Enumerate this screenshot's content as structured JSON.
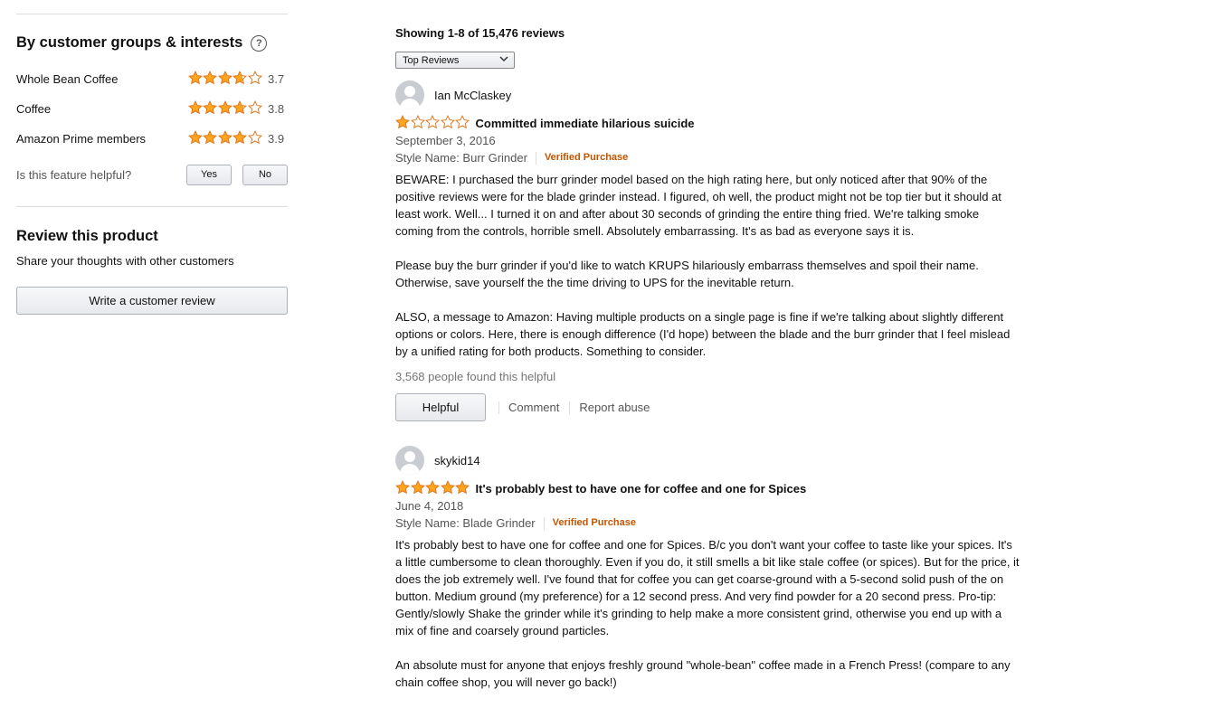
{
  "sidebar": {
    "groups_title": "By customer groups & interests",
    "help_icon_glyph": "?",
    "groups": [
      {
        "label": "Whole Bean Coffee",
        "rating": 3.7,
        "rating_text": "3.7"
      },
      {
        "label": "Coffee",
        "rating": 3.8,
        "rating_text": "3.8"
      },
      {
        "label": "Amazon Prime members",
        "rating": 3.9,
        "rating_text": "3.9"
      }
    ],
    "feature_question": "Is this feature helpful?",
    "yes_label": "Yes",
    "no_label": "No",
    "review_title": "Review this product",
    "share_text": "Share your thoughts with other customers",
    "write_review_label": "Write a customer review"
  },
  "main": {
    "showing_text": "Showing 1-8 of 15,476 reviews",
    "sort_selected": "Top Reviews",
    "reviews": [
      {
        "author": "Ian McClaskey",
        "rating": 1,
        "title": "Committed immediate hilarious suicide",
        "date": "September 3, 2016",
        "style": "Style Name: Burr Grinder",
        "verified": "Verified Purchase",
        "paragraphs": [
          "BEWARE: I purchased the burr grinder model based on the high rating here, but only noticed after that 90% of the positive reviews were for the blade grinder instead. I figured, oh well, the product might not be top tier but it should at least work. Well... I turned it on and after about 30 seconds of grinding the entire thing fried. We're talking smoke coming from the controls, horrible smell. Absolutely embarrassing. It's as bad as everyone says it is.",
          "Please buy the burr grinder if you'd like to watch KRUPS hilariously embarrass themselves and spoil their name. Otherwise, save yourself the the time driving to UPS for the inevitable return.",
          "ALSO, a message to Amazon: Having multiple products on a single page is fine if we're talking about slightly different options or colors. Here, there is enough difference (I'd hope) between the blade and the burr grinder that I feel mislead by a unified rating for both products. Something to consider."
        ],
        "helpful_count": "3,568 people found this helpful",
        "helpful_label": "Helpful",
        "comment_label": "Comment",
        "report_label": "Report abuse"
      },
      {
        "author": "skykid14",
        "rating": 5,
        "title": "It's probably best to have one for coffee and one for Spices",
        "date": "June 4, 2018",
        "style": "Style Name: Blade Grinder",
        "verified": "Verified Purchase",
        "paragraphs": [
          "It's probably best to have one for coffee and one for Spices. B/c you don't want your coffee to taste like your spices. It's a little cumbersome to clean thoroughly. Even if you do, it still smells a bit like stale coffee (or spices). But for the price, it does the job extremely well. I've found that for coffee you can get coarse-ground with a 5-second solid push of the on button. Medium ground (my preference) for a 12 second press. And very find powder for a 20 second press. Pro-tip: Gently/slowly Shake the grinder while it's grinding to help make a more consistent grind, otherwise you end up with a mix of fine and coarsely ground particles.",
          "An absolute must for anyone that enjoys freshly ground \"whole-bean\" coffee made in a French Press! (compare to any chain coffee shop, you will never go back!)"
        ]
      }
    ]
  },
  "colors": {
    "star_fill": "#ffa41c",
    "star_stroke": "#de7921",
    "verified": "#c45500"
  }
}
